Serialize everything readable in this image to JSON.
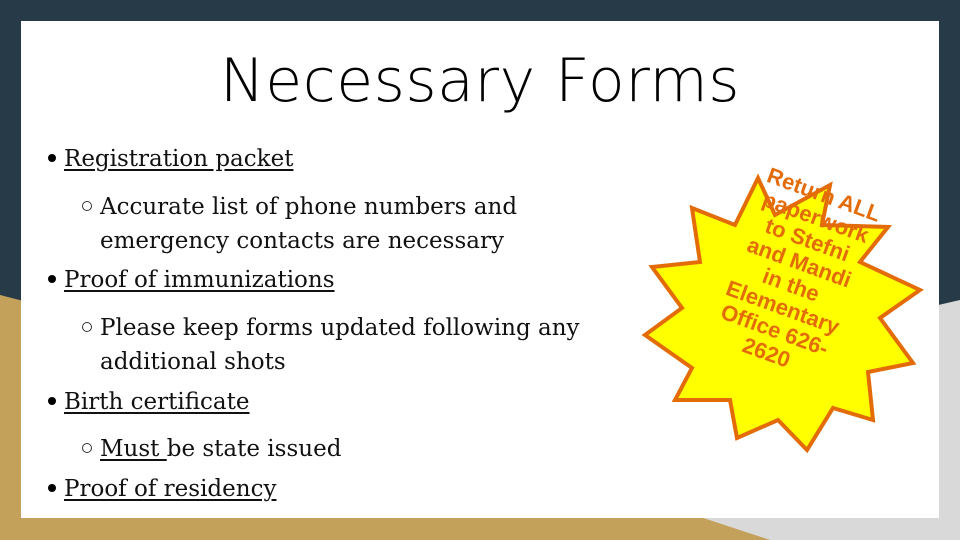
{
  "slide": {
    "title": "Necessary Forms",
    "colors": {
      "frame_dark": "#263a47",
      "frame_tan": "#c4a15a",
      "frame_gray": "#d9d9d9",
      "card": "#ffffff",
      "star_fill": "#ffff00",
      "star_stroke": "#e36c09",
      "star_text": "#e36c09"
    },
    "bullets": [
      {
        "label": "Registration packet",
        "sub": [
          {
            "line1": "Accurate list of phone numbers and",
            "line2": "emergency contacts are necessary"
          }
        ]
      },
      {
        "label": "Proof of immunizations",
        "sub": [
          {
            "line1": "Please keep forms updated following any",
            "line2": "additional shots"
          }
        ]
      },
      {
        "label": "Birth certificate",
        "sub": [
          {
            "underlined": "Must ",
            "rest": "be state issued"
          }
        ]
      },
      {
        "label": "Proof of residency"
      }
    ],
    "callout": {
      "shape": "starburst-12",
      "lines": [
        "Return ALL",
        "paperwork",
        "to Stefni",
        "and Mandi",
        "in the",
        "Elementary",
        "Office 626-",
        "2620"
      ]
    }
  }
}
